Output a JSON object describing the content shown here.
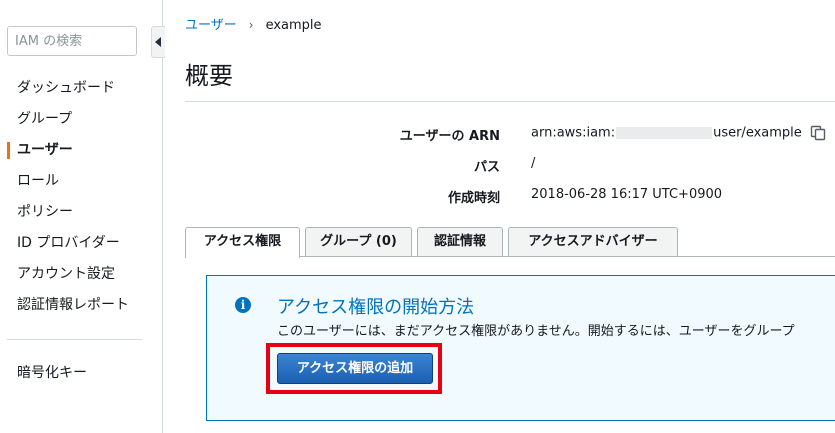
{
  "sidebar": {
    "search_placeholder": "IAM の検索",
    "items": [
      {
        "label": "ダッシュボード",
        "active": false
      },
      {
        "label": "グループ",
        "active": false
      },
      {
        "label": "ユーザー",
        "active": true
      },
      {
        "label": "ロール",
        "active": false
      },
      {
        "label": "ポリシー",
        "active": false
      },
      {
        "label": "ID プロバイダー",
        "active": false
      },
      {
        "label": "アカウント設定",
        "active": false
      },
      {
        "label": "認証情報レポート",
        "active": false
      }
    ],
    "extra_items": [
      {
        "label": "暗号化キー"
      }
    ]
  },
  "breadcrumb": {
    "parent": "ユーザー",
    "separator": "›",
    "current": "example"
  },
  "page": {
    "title": "概要"
  },
  "summary": {
    "arn": {
      "label": "ユーザーの ARN",
      "prefix": "arn:aws:iam:",
      "suffix": "user/example"
    },
    "path": {
      "label": "パス",
      "value": "/"
    },
    "created": {
      "label": "作成時刻",
      "value": "2018-06-28 16:17 UTC+0900"
    }
  },
  "tabs": [
    {
      "label": "アクセス権限",
      "active": true
    },
    {
      "label": "グループ (0)",
      "active": false
    },
    {
      "label": "認証情報",
      "active": false
    },
    {
      "label": "アクセスアドバイザー",
      "active": false
    }
  ],
  "info_box": {
    "icon": "info-icon",
    "title": "アクセス権限の開始方法",
    "text": "このユーザーには、まだアクセス権限がありません。開始するには、ユーザーをグループ",
    "button_label": "アクセス権限の追加"
  },
  "colors": {
    "link": "#0073bb",
    "accent": "#ec7211",
    "highlight": "#e60012",
    "primary_button": "#1b5fb1"
  }
}
